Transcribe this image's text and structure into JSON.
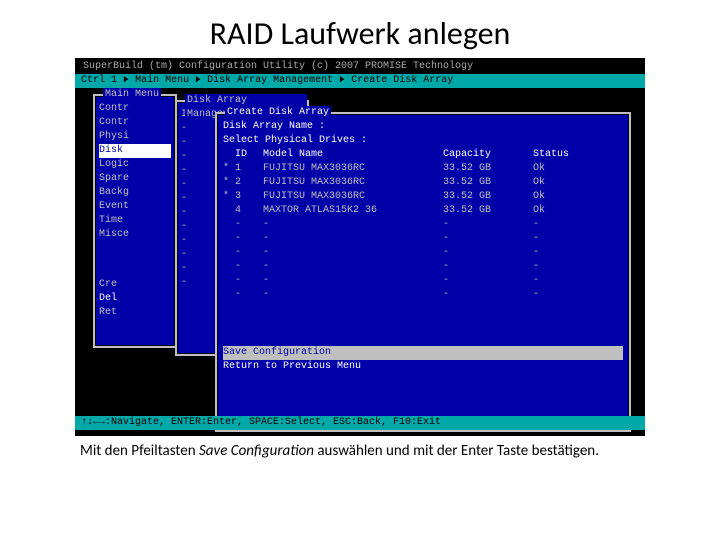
{
  "slide_title": "RAID Laufwerk anlegen",
  "util_header": "SuperBuild (tm) Configuration Utility (c) 2007 PROMISE Technology",
  "breadcrumb": {
    "ctrl": "Ctrl 1",
    "sep": "►",
    "a": "Main Menu",
    "b": "Disk Array Management",
    "c": "Create Disk Array"
  },
  "hints": "↑↓←→:Navigate, ENTER:Enter, SPACE:Select, ESC:Back, F10:Exit",
  "main_menu": {
    "title": "Main Menu",
    "items": [
      "Contr",
      "Contr",
      "Physi",
      "Disk",
      "Logic",
      "Spare",
      "Backg",
      "Event",
      "Time",
      "Misce"
    ],
    "sel_index": 3,
    "footer": [
      "Cre",
      "Del",
      "Ret"
    ]
  },
  "dam": {
    "title": "Disk Array Management",
    "row": "ID   -"
  },
  "cda": {
    "title": "Create Disk Array",
    "name_label": "Disk Array Name :",
    "sel_label": "Select Physical Drives :",
    "cols": {
      "id": "ID",
      "model": "Model Name",
      "cap": "Capacity",
      "status": "Status"
    },
    "rows": [
      {
        "ck": "*",
        "id": "1",
        "model": "FUJITSU MAX3036RC",
        "cap": "33.52 GB",
        "status": "Ok"
      },
      {
        "ck": "*",
        "id": "2",
        "model": "FUJITSU MAX3036RC",
        "cap": "33.52 GB",
        "status": "Ok"
      },
      {
        "ck": "*",
        "id": "3",
        "model": "FUJITSU MAX3036RC",
        "cap": "33.52 GB",
        "status": "Ok"
      },
      {
        "ck": "",
        "id": "4",
        "model": "MAXTOR  ATLAS15K2 36",
        "cap": "33.52 GB",
        "status": "Ok"
      }
    ],
    "empty": "-",
    "menu": {
      "save": "Save Configuration",
      "return": "Return to Previous Menu"
    },
    "sel_menu": 0
  },
  "caption": {
    "a": "Mit den Pfeiltasten ",
    "b": "Save Configuration",
    "c": " auswählen und mit der Enter Taste bestätigen."
  }
}
